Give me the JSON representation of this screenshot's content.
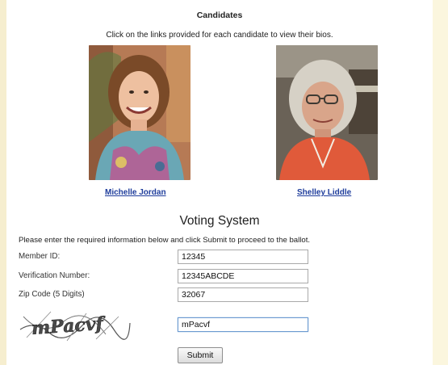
{
  "candidates_section": {
    "heading": "Candidates",
    "subheading": "Click on the links provided for each candidate to view their bios.",
    "candidates": [
      {
        "name": "Michelle Jordan"
      },
      {
        "name": "Shelley Liddle"
      }
    ]
  },
  "voting": {
    "title": "Voting System",
    "instructions": "Please enter the required information below and click Submit to proceed to the ballot.",
    "fields": [
      {
        "label": "Member ID:",
        "value": "12345"
      },
      {
        "label": "Verification Number:",
        "value": "12345ABCDE"
      },
      {
        "label": "Zip Code (5 Digits)",
        "value": "32067"
      }
    ],
    "captcha": {
      "image_text": "mPacvf",
      "input_value": "mPacvf"
    },
    "submit_label": "Submit"
  },
  "colors": {
    "link": "#1f3d9c",
    "page_background": "#fdfbf1",
    "panel_background": "#ffffff",
    "focus_border": "#6d9bd1"
  }
}
